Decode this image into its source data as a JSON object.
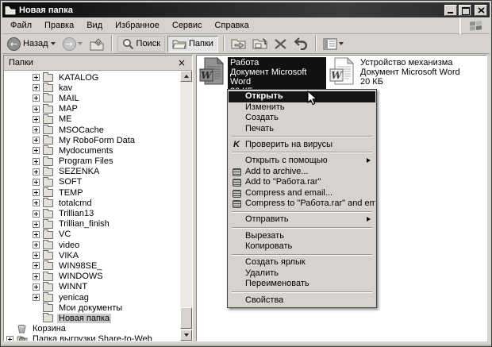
{
  "window": {
    "title": "Новая папка"
  },
  "titlebar": {
    "buttons": [
      "minimize",
      "maximize",
      "close"
    ]
  },
  "menubar": {
    "items": [
      "Файл",
      "Правка",
      "Вид",
      "Избранное",
      "Сервис",
      "Справка"
    ]
  },
  "toolbar": {
    "back_label": "Назад",
    "search_label": "Поиск",
    "folders_label": "Папки"
  },
  "folders_panel": {
    "title": "Папки",
    "close_glyph": "×"
  },
  "tree": {
    "items": [
      {
        "label": "KATALOG",
        "level": 2,
        "expandable": true,
        "icon": "folder",
        "selected": false
      },
      {
        "label": "kav",
        "level": 2,
        "expandable": true,
        "icon": "folder",
        "selected": false
      },
      {
        "label": "MAIL",
        "level": 2,
        "expandable": true,
        "icon": "folder",
        "selected": false
      },
      {
        "label": "MAP",
        "level": 2,
        "expandable": true,
        "icon": "folder",
        "selected": false
      },
      {
        "label": "ME",
        "level": 2,
        "expandable": true,
        "icon": "folder",
        "selected": false
      },
      {
        "label": "MSOCache",
        "level": 2,
        "expandable": true,
        "icon": "folder",
        "selected": false
      },
      {
        "label": "My RoboForm Data",
        "level": 2,
        "expandable": true,
        "icon": "folder",
        "selected": false
      },
      {
        "label": "Mydocuments",
        "level": 2,
        "expandable": true,
        "icon": "folder",
        "selected": false
      },
      {
        "label": "Program Files",
        "level": 2,
        "expandable": true,
        "icon": "folder",
        "selected": false
      },
      {
        "label": "SEZENKA",
        "level": 2,
        "expandable": true,
        "icon": "folder",
        "selected": false
      },
      {
        "label": "SOFT",
        "level": 2,
        "expandable": true,
        "icon": "folder",
        "selected": false
      },
      {
        "label": "TEMP",
        "level": 2,
        "expandable": true,
        "icon": "folder",
        "selected": false
      },
      {
        "label": "totalcmd",
        "level": 2,
        "expandable": true,
        "icon": "folder",
        "selected": false
      },
      {
        "label": "Trillian13",
        "level": 2,
        "expandable": true,
        "icon": "folder",
        "selected": false
      },
      {
        "label": "Trillian_finish",
        "level": 2,
        "expandable": true,
        "icon": "folder",
        "selected": false
      },
      {
        "label": "VC",
        "level": 2,
        "expandable": true,
        "icon": "folder",
        "selected": false
      },
      {
        "label": "video",
        "level": 2,
        "expandable": true,
        "icon": "folder",
        "selected": false
      },
      {
        "label": "VIKA",
        "level": 2,
        "expandable": true,
        "icon": "folder",
        "selected": false
      },
      {
        "label": "WIN98SE_",
        "level": 2,
        "expandable": true,
        "icon": "folder",
        "selected": false
      },
      {
        "label": "WINDOWS",
        "level": 2,
        "expandable": true,
        "icon": "folder",
        "selected": false
      },
      {
        "label": "WINNT",
        "level": 2,
        "expandable": true,
        "icon": "folder",
        "selected": false
      },
      {
        "label": "yenicag",
        "level": 2,
        "expandable": true,
        "icon": "folder",
        "selected": false
      },
      {
        "label": "Мои документы",
        "level": 2,
        "expandable": false,
        "icon": "folder",
        "selected": false
      },
      {
        "label": "Новая папка",
        "level": 2,
        "expandable": false,
        "icon": "folder",
        "selected": true
      },
      {
        "label": "Корзина",
        "level": 1,
        "expandable": false,
        "icon": "recycle-bin",
        "selected": false
      },
      {
        "label": "Папка выгрузки Share-to-Web",
        "level": 1,
        "expandable": true,
        "icon": "web-folder",
        "selected": false
      }
    ]
  },
  "files": [
    {
      "name": "Работа",
      "type": "Документ Microsoft Word",
      "size": "20 КБ",
      "selected": true
    },
    {
      "name": "Устройство механизма",
      "type": "Документ Microsoft Word",
      "size": "20 КБ",
      "selected": false
    }
  ],
  "context_menu": {
    "items": [
      {
        "label": "Открыть",
        "bold": true,
        "highlighted": true
      },
      {
        "label": "Изменить"
      },
      {
        "label": "Создать"
      },
      {
        "label": "Печать"
      },
      {
        "separator": true
      },
      {
        "label": "Проверить на вирусы",
        "icon": "antivirus"
      },
      {
        "separator": true
      },
      {
        "label": "Открыть с помощью",
        "submenu": true
      },
      {
        "label": "Add to archive...",
        "icon": "winrar"
      },
      {
        "label": "Add to \"Работа.rar\"",
        "icon": "winrar"
      },
      {
        "label": "Compress and email...",
        "icon": "winrar"
      },
      {
        "label": "Compress to \"Работа.rar\" and email",
        "icon": "winrar"
      },
      {
        "separator": true
      },
      {
        "label": "Отправить",
        "submenu": true
      },
      {
        "separator": true
      },
      {
        "label": "Вырезать"
      },
      {
        "label": "Копировать"
      },
      {
        "separator": true
      },
      {
        "label": "Создать ярлык"
      },
      {
        "label": "Удалить"
      },
      {
        "label": "Переименовать"
      },
      {
        "separator": true
      },
      {
        "label": "Свойства"
      }
    ]
  }
}
